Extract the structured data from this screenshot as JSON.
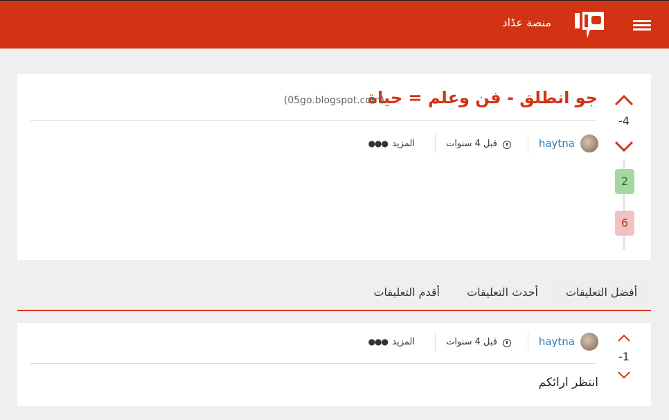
{
  "header": {
    "site_name": "منصة عڈاد",
    "menu_icon": "hamburger-icon",
    "logo_icon": "site-logo",
    "bg_color": "#d23413"
  },
  "post": {
    "title": "جو انطلق - فن وعلم = حياة",
    "domain": "(05go.blogspot.com)",
    "score": "-4",
    "upvotes": "2",
    "downvotes": "6",
    "author": "haytna",
    "time": "قبل 4 سنوات",
    "more_label": "المزيد"
  },
  "tabs": [
    {
      "label": "أفضل التعليقات",
      "active": true
    },
    {
      "label": "أحدث التعليقات",
      "active": false
    },
    {
      "label": "أقدم التعليقات",
      "active": false
    }
  ],
  "comment": {
    "score": "-1",
    "author": "haytna",
    "time": "قبل 4 سنوات",
    "more_label": "المزيد",
    "text": "انتظر ارائكم"
  }
}
